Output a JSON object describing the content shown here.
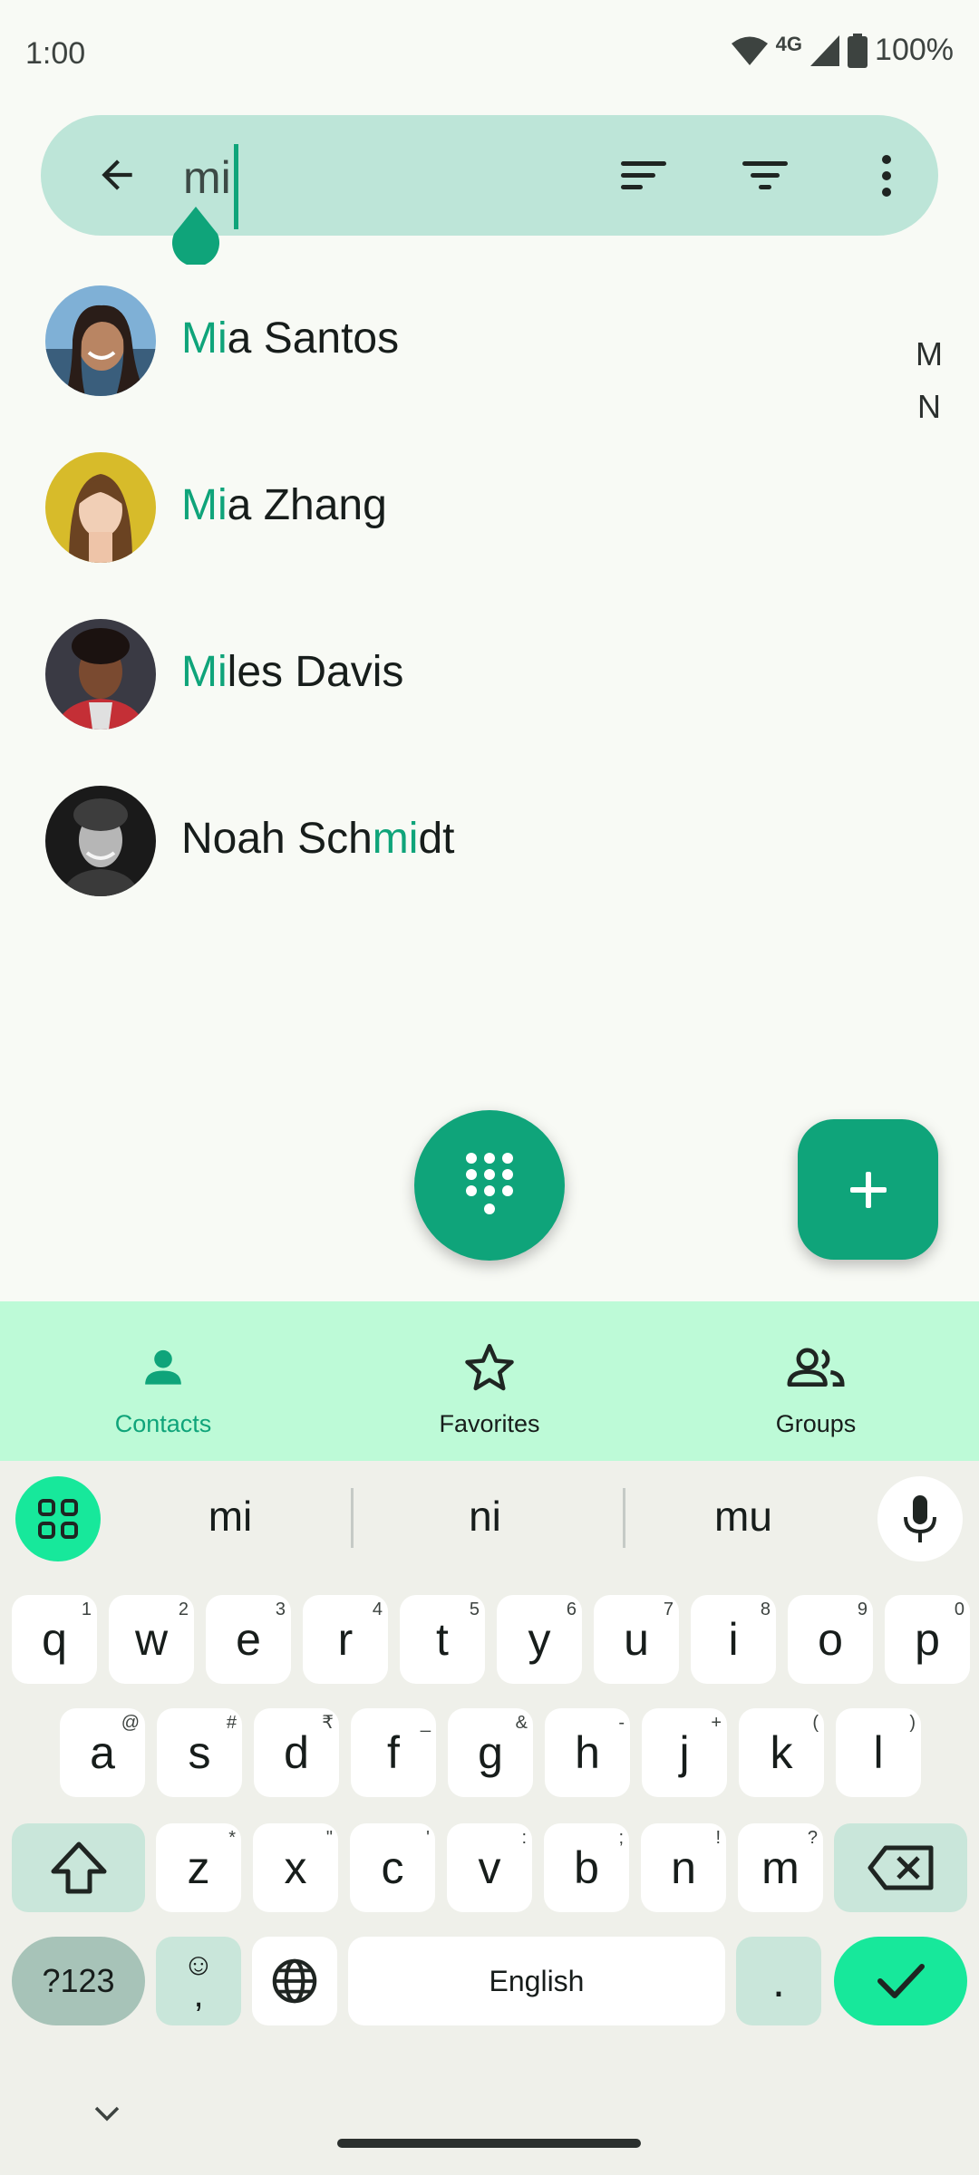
{
  "status_bar": {
    "time": "1:00",
    "network_label": "4G",
    "battery": "100%",
    "icons": [
      "wifi-icon",
      "signal-icon",
      "battery-icon"
    ]
  },
  "search": {
    "query": "mi",
    "back_icon": "arrow-back-icon",
    "sort_icon": "sort-icon",
    "filter_icon": "filter-icon",
    "more_icon": "more-vert-icon"
  },
  "contacts": [
    {
      "pre": "",
      "match": "Mi",
      "post": "a Santos",
      "avatar_color": "#6a93b8"
    },
    {
      "pre": "",
      "match": "Mi",
      "post": "a Zhang",
      "avatar_color": "#d8b92a"
    },
    {
      "pre": "",
      "match": "Mi",
      "post": "les Davis",
      "avatar_color": "#5a2c2c"
    },
    {
      "pre": "Noah Sch",
      "match": "mi",
      "post": "dt",
      "avatar_color": "#2a2a2a"
    }
  ],
  "index_letters": [
    "M",
    "N"
  ],
  "fabs": {
    "dialpad_icon": "dialpad-icon",
    "add_icon": "add-icon"
  },
  "bottom_nav": {
    "items": [
      {
        "label": "Contacts",
        "icon": "person-icon",
        "active": true
      },
      {
        "label": "Favorites",
        "icon": "star-icon",
        "active": false
      },
      {
        "label": "Groups",
        "icon": "group-icon",
        "active": false
      }
    ]
  },
  "keyboard": {
    "suggestions": [
      "mi",
      "ni",
      "mu"
    ],
    "row1": [
      {
        "k": "q",
        "s": "1"
      },
      {
        "k": "w",
        "s": "2"
      },
      {
        "k": "e",
        "s": "3"
      },
      {
        "k": "r",
        "s": "4"
      },
      {
        "k": "t",
        "s": "5"
      },
      {
        "k": "y",
        "s": "6"
      },
      {
        "k": "u",
        "s": "7"
      },
      {
        "k": "i",
        "s": "8"
      },
      {
        "k": "o",
        "s": "9"
      },
      {
        "k": "p",
        "s": "0"
      }
    ],
    "row2": [
      {
        "k": "a",
        "s": "@"
      },
      {
        "k": "s",
        "s": "#"
      },
      {
        "k": "d",
        "s": "₹"
      },
      {
        "k": "f",
        "s": "_"
      },
      {
        "k": "g",
        "s": "&"
      },
      {
        "k": "h",
        "s": "-"
      },
      {
        "k": "j",
        "s": "+"
      },
      {
        "k": "k",
        "s": "("
      },
      {
        "k": "l",
        "s": ")"
      }
    ],
    "row3": [
      {
        "k": "z",
        "s": "*"
      },
      {
        "k": "x",
        "s": "\""
      },
      {
        "k": "c",
        "s": "'"
      },
      {
        "k": "v",
        "s": ":"
      },
      {
        "k": "b",
        "s": ";"
      },
      {
        "k": "n",
        "s": "!"
      },
      {
        "k": "m",
        "s": "?"
      }
    ],
    "symbols_label": "?123",
    "emoji_top": "☺",
    "emoji_bottom": ",",
    "space_label": "English",
    "period_label": "."
  },
  "colors": {
    "accent": "#0fa47a",
    "search_bg": "#bde5d8",
    "nav_bg": "#bdfad7",
    "keyboard_bg": "#eff0ea"
  }
}
